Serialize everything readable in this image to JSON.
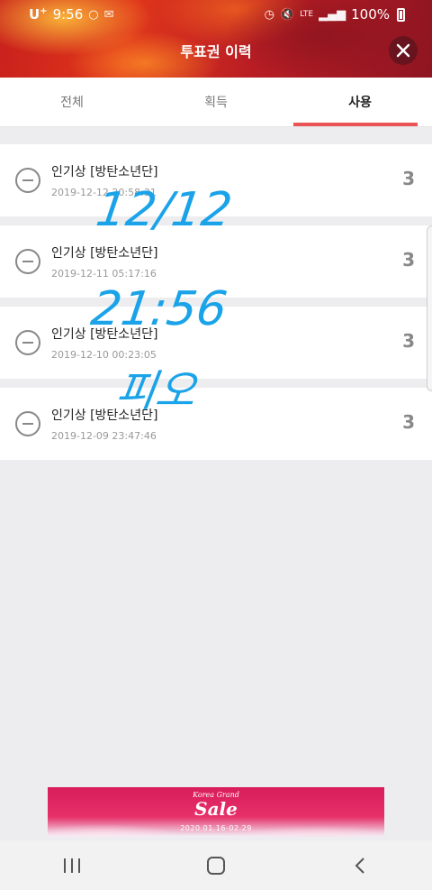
{
  "status_bar": {
    "carrier": "U",
    "carrier_sup": "+",
    "time": "9:56",
    "network": "LTE",
    "battery": "100%"
  },
  "header": {
    "title": "투표권 이력"
  },
  "tabs": [
    {
      "label": "전체",
      "active": false
    },
    {
      "label": "획득",
      "active": false
    },
    {
      "label": "사용",
      "active": true
    }
  ],
  "items": [
    {
      "title": "인기상 [방탄소년단]",
      "date": "2019-12-12 20:58:31",
      "count": "3"
    },
    {
      "title": "인기상 [방탄소년단]",
      "date": "2019-12-11 05:17:16",
      "count": "3"
    },
    {
      "title": "인기상 [방탄소년단]",
      "date": "2019-12-10 00:23:05",
      "count": "3"
    },
    {
      "title": "인기상 [방탄소년단]",
      "date": "2019-12-09 23:47:46",
      "count": "3"
    }
  ],
  "handwriting": {
    "line1": "12/12",
    "line2": "21:56",
    "line3": "피오"
  },
  "banner": {
    "small_text": "Korea Grand",
    "big_text": "Sale",
    "dates": "2020.01.16-02.29"
  },
  "colors": {
    "accent": "#ea5455",
    "handwriting": "#1aa3e8"
  }
}
